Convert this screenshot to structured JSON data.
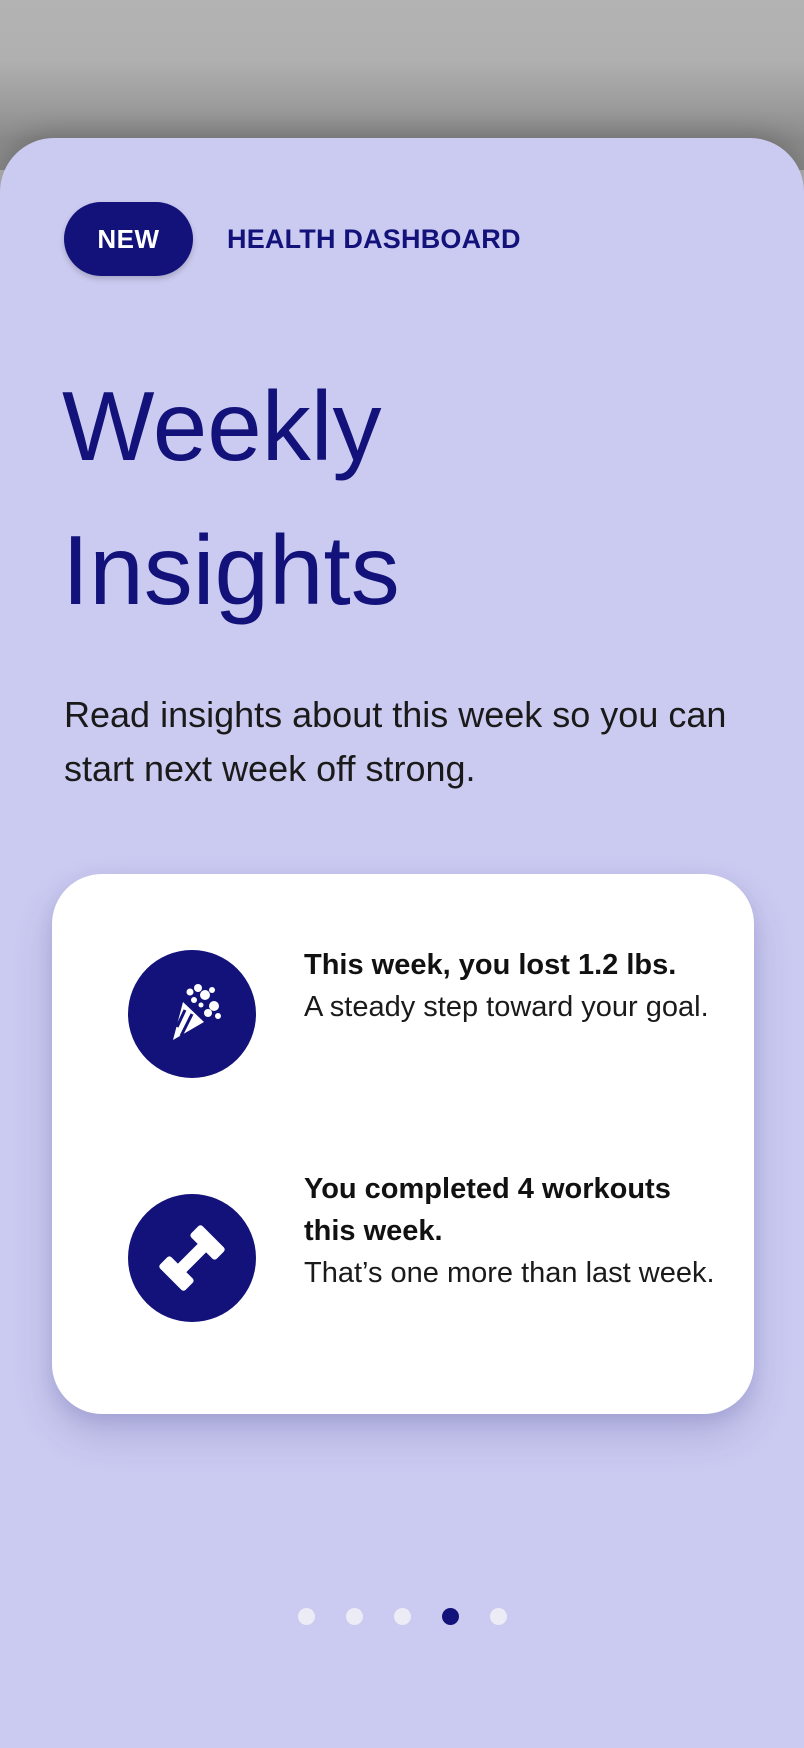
{
  "header": {
    "badge_label": "NEW",
    "eyebrow": "HEALTH DASHBOARD"
  },
  "title_lines": [
    "Weekly",
    "Insights"
  ],
  "subtitle": "Read insights about this week so you can start next week off strong.",
  "insights": [
    {
      "icon": "party-popper-icon",
      "headline": "This week, you lost 1.2 lbs.",
      "body": "A steady step toward your goal."
    },
    {
      "icon": "dumbbell-icon",
      "headline": "You completed 4 workouts this week.",
      "body": "That’s one more than last week."
    }
  ],
  "pagination": {
    "total": 5,
    "active_page": 4
  },
  "colors": {
    "accent": "#12127a",
    "sheet_background": "#cbcaf0",
    "card_background": "#ffffff",
    "dot_inactive": "#ececf7"
  }
}
